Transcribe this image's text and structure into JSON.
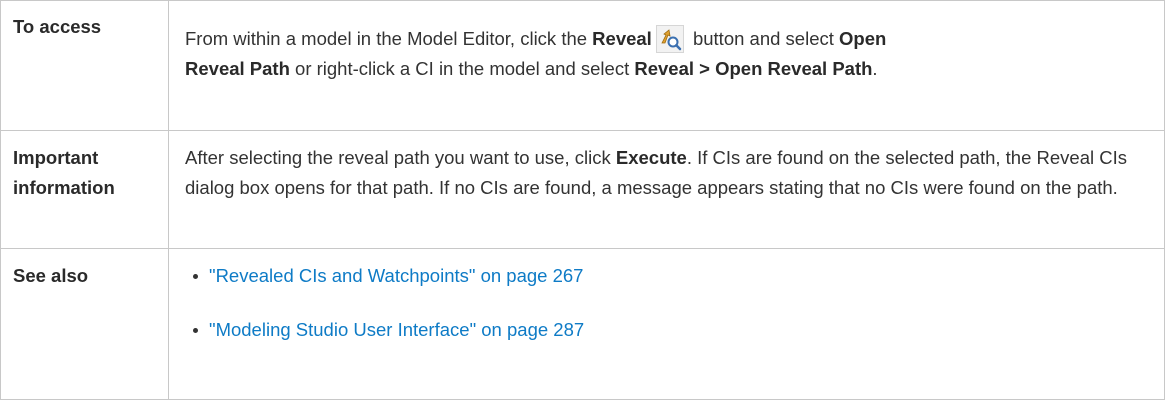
{
  "rows": [
    {
      "label": "To access",
      "line1_pre": "From within a model in the Model Editor, click the ",
      "reveal_bold": "Reveal",
      "line1_post": " button and select ",
      "open_bold": "Open",
      "reveal_path_bold": "Reveal Path",
      "line2_mid": " or right-click a CI in the model and select ",
      "menu_path_bold": "Reveal > Open Reveal Path",
      "period": "."
    },
    {
      "label_line1": "Important",
      "label_line2": "information",
      "text_pre": "After selecting the reveal path you want to use, click ",
      "execute_bold": "Execute",
      "text_post": ". If CIs are found on the selected path, the Reveal CIs dialog box opens for that path. If no CIs are found, a message appears stating that no CIs were found on the path."
    },
    {
      "label": "See also",
      "links": [
        "\"Revealed CIs and Watchpoints\" on page 267",
        "\"Modeling Studio User Interface\" on page 287"
      ]
    }
  ],
  "colors": {
    "link": "#0e7bc6",
    "border": "#c8c8c8",
    "text": "#333333"
  },
  "icons": {
    "reveal": "reveal-magnifier-icon"
  }
}
